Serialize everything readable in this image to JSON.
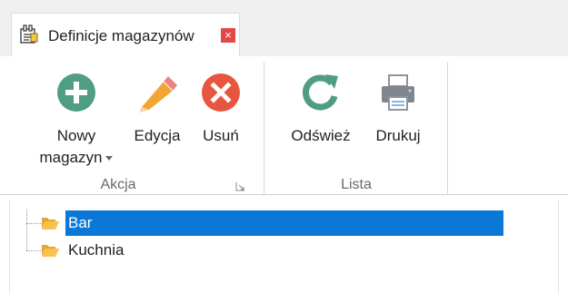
{
  "tab": {
    "title": "Definicje magazynów",
    "close_label": "×",
    "icon": "warehouse-definition-icon"
  },
  "ribbon": {
    "groups": [
      {
        "label": "Akcja",
        "buttons": [
          {
            "label_line1": "Nowy",
            "label_line2": "magazyn",
            "icon": "add-circle-icon",
            "has_dropdown": true
          },
          {
            "label": "Edycja",
            "icon": "pencil-icon"
          },
          {
            "label": "Usuń",
            "icon": "delete-circle-icon"
          }
        ]
      },
      {
        "label": "Lista",
        "buttons": [
          {
            "label": "Odśwież",
            "icon": "refresh-icon"
          },
          {
            "label": "Drukuj",
            "icon": "printer-icon"
          }
        ]
      }
    ]
  },
  "tree": {
    "items": [
      {
        "label": "Bar",
        "selected": true,
        "icon": "folder-open-icon"
      },
      {
        "label": "Kuchnia",
        "selected": false,
        "icon": "folder-open-icon"
      }
    ]
  },
  "colors": {
    "selection": "#0b78d7",
    "add_green": "#4f9e83",
    "delete_red": "#e8553f",
    "refresh_teal": "#4f9e83",
    "close_red": "#e24848"
  }
}
